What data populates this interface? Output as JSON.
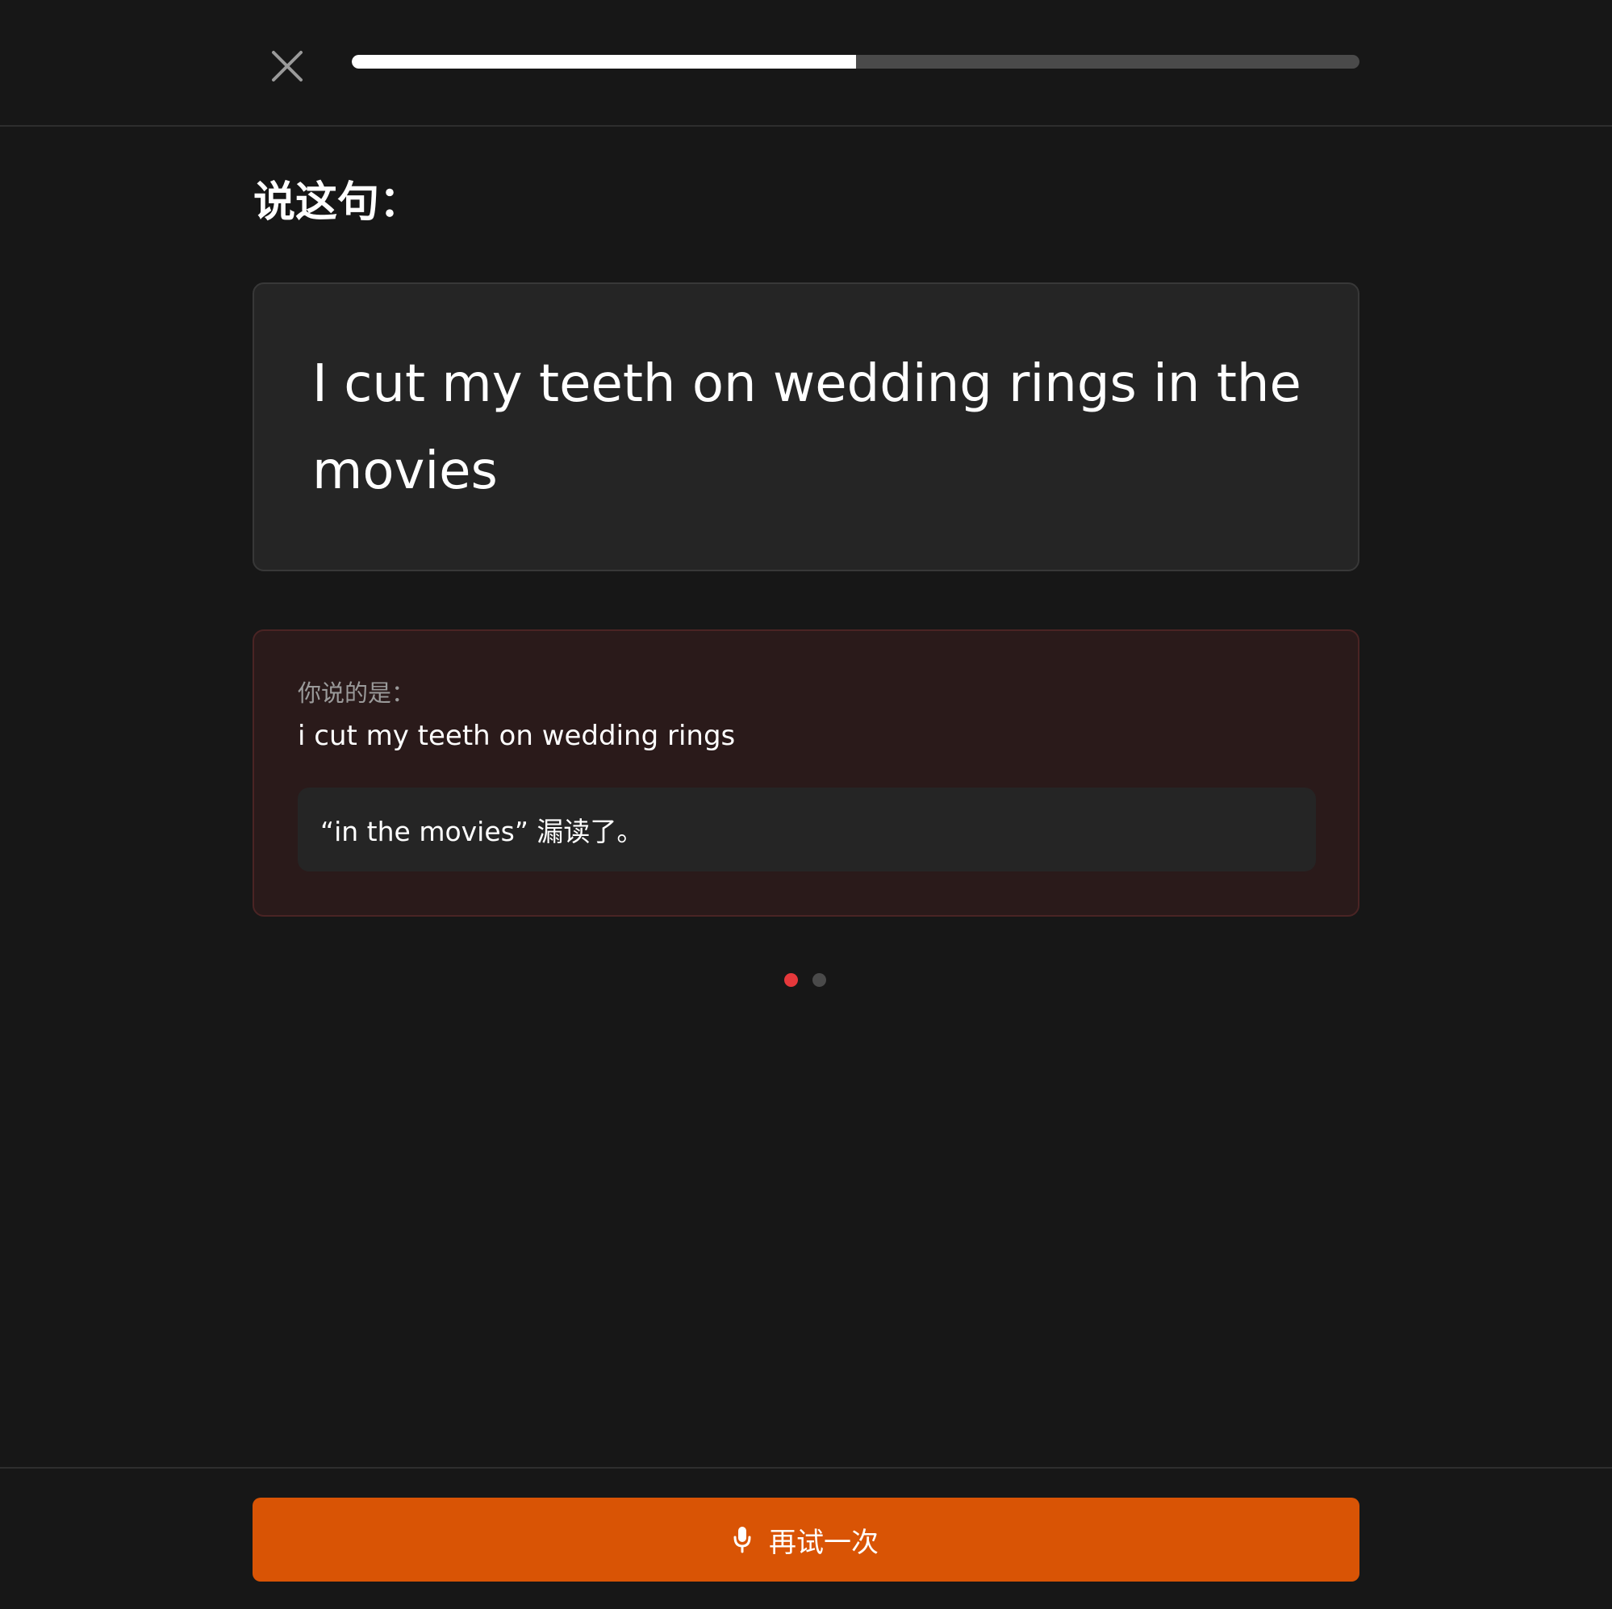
{
  "header": {
    "close_icon": "close-icon",
    "progress_fraction": 0.5
  },
  "prompt": {
    "title": "说这句："
  },
  "sentence": {
    "text": "I cut my teeth on wedding rings in the movies"
  },
  "result": {
    "label": "你说的是：",
    "transcript": "i cut my teeth on wedding rings",
    "feedback": "“in the movies” 漏读了。"
  },
  "pager": {
    "count": 2,
    "active_index": 0,
    "active_color": "#e5383b",
    "inactive_color": "#4a4a4a"
  },
  "footer": {
    "retry_label": "再试一次",
    "retry_icon": "microphone-icon",
    "button_color": "#d95405"
  }
}
